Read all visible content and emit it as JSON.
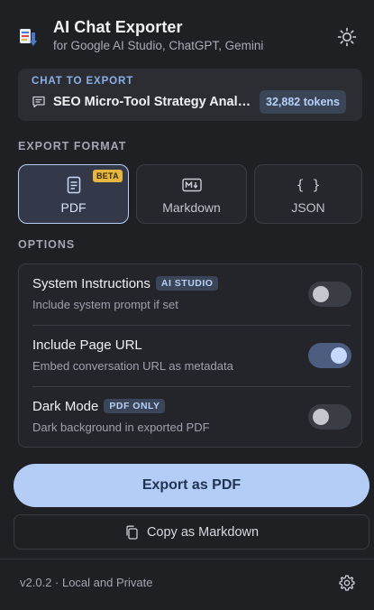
{
  "header": {
    "title": "AI Chat Exporter",
    "subtitle": "for Google AI Studio, ChatGPT, Gemini",
    "theme_icon": "sun-icon"
  },
  "chat": {
    "label": "CHAT TO EXPORT",
    "title": "SEO Micro-Tool Strategy Anal…",
    "tokens": "32,882 tokens",
    "icon": "chat-bubble-icon"
  },
  "format": {
    "label": "EXPORT FORMAT",
    "selected": "PDF",
    "options": [
      {
        "label": "PDF",
        "icon": "document-icon",
        "badge": "BETA",
        "active": true
      },
      {
        "label": "Markdown",
        "icon": "markdown-icon",
        "active": false
      },
      {
        "label": "JSON",
        "icon": "braces-icon",
        "glyph": "{ }",
        "active": false
      }
    ]
  },
  "options": {
    "label": "OPTIONS",
    "items": [
      {
        "title": "System Instructions",
        "badge": "AI STUDIO",
        "desc": "Include system prompt if set",
        "enabled": false
      },
      {
        "title": "Include Page URL",
        "desc": "Embed conversation URL as metadata",
        "enabled": true
      },
      {
        "title": "Dark Mode",
        "badge": "PDF ONLY",
        "desc": "Dark background in exported PDF",
        "enabled": false
      }
    ]
  },
  "actions": {
    "export_label": "Export as PDF",
    "copy_label": "Copy as Markdown"
  },
  "footer": {
    "version": "v2.0.2 · Local and Private",
    "settings_icon": "gear-icon"
  },
  "colors": {
    "background": "#1f2024",
    "accent": "#b4cdf6",
    "beta_badge": "#e6b73e"
  }
}
